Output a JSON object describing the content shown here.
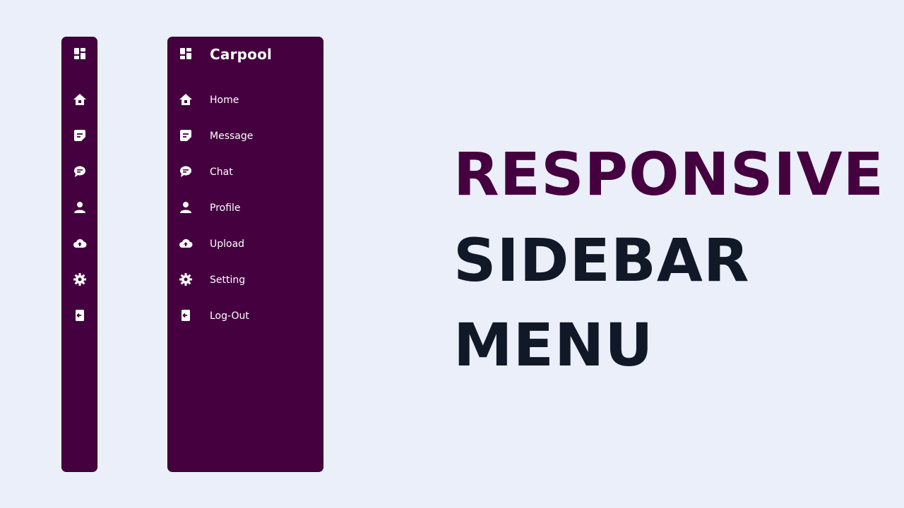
{
  "brand": {
    "title": "Carpool",
    "icon": "grid-icon"
  },
  "nav": [
    {
      "id": "home",
      "label": "Home",
      "icon": "home-icon"
    },
    {
      "id": "message",
      "label": "Message",
      "icon": "message-icon"
    },
    {
      "id": "chat",
      "label": "Chat",
      "icon": "chat-icon"
    },
    {
      "id": "profile",
      "label": "Profile",
      "icon": "user-icon"
    },
    {
      "id": "upload",
      "label": "Upload",
      "icon": "cloud-upload-icon"
    },
    {
      "id": "setting",
      "label": "Setting",
      "icon": "gear-icon"
    },
    {
      "id": "logout",
      "label": "Log-Out",
      "icon": "logout-icon"
    }
  ],
  "headline": {
    "line1": "RESPONSIVE",
    "line2": "SIDEBAR",
    "line3": "MENU"
  },
  "colors": {
    "background": "#ebeffa",
    "sidebar": "#450040",
    "accent_text": "#450040",
    "dark_text": "#111827",
    "icon": "#ffffff"
  }
}
